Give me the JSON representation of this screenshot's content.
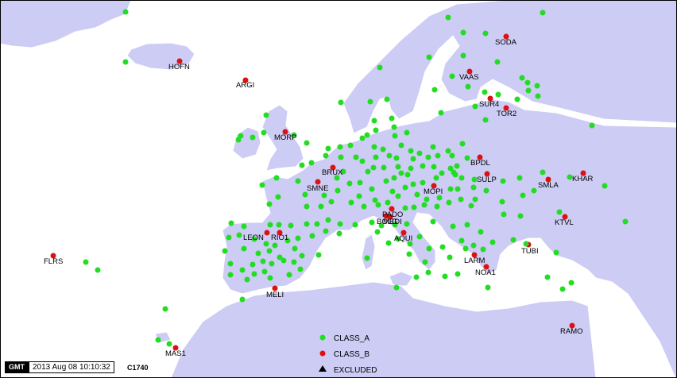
{
  "legend": {
    "class_a": "CLASS_A",
    "class_b": "CLASS_B",
    "excluded": "EXCLUDED"
  },
  "stamp": {
    "logo": "GMT",
    "datetime": "2013 Aug 08 10:10:32",
    "code": "C1740"
  },
  "colors": {
    "class_a": "#22dd22",
    "class_b": "#dd1111",
    "excluded": "#000000",
    "land": "#ccccf5"
  },
  "stations_b": [
    "HOFN",
    "ARGI",
    "SODA",
    "VAAS",
    "SUR4",
    "TOR2",
    "MORP",
    "BPDL",
    "BRUX",
    "SULP",
    "KHAR",
    "SMNE",
    "SMLA",
    "MOPI",
    "KTVL",
    "PADO",
    "BOLG",
    "MEDI",
    "LEON",
    "RIO1",
    "AQUI",
    "LARM",
    "TUBI",
    "NOA1",
    "FLRS",
    "MELI",
    "RAMO",
    "MAS1"
  ]
}
